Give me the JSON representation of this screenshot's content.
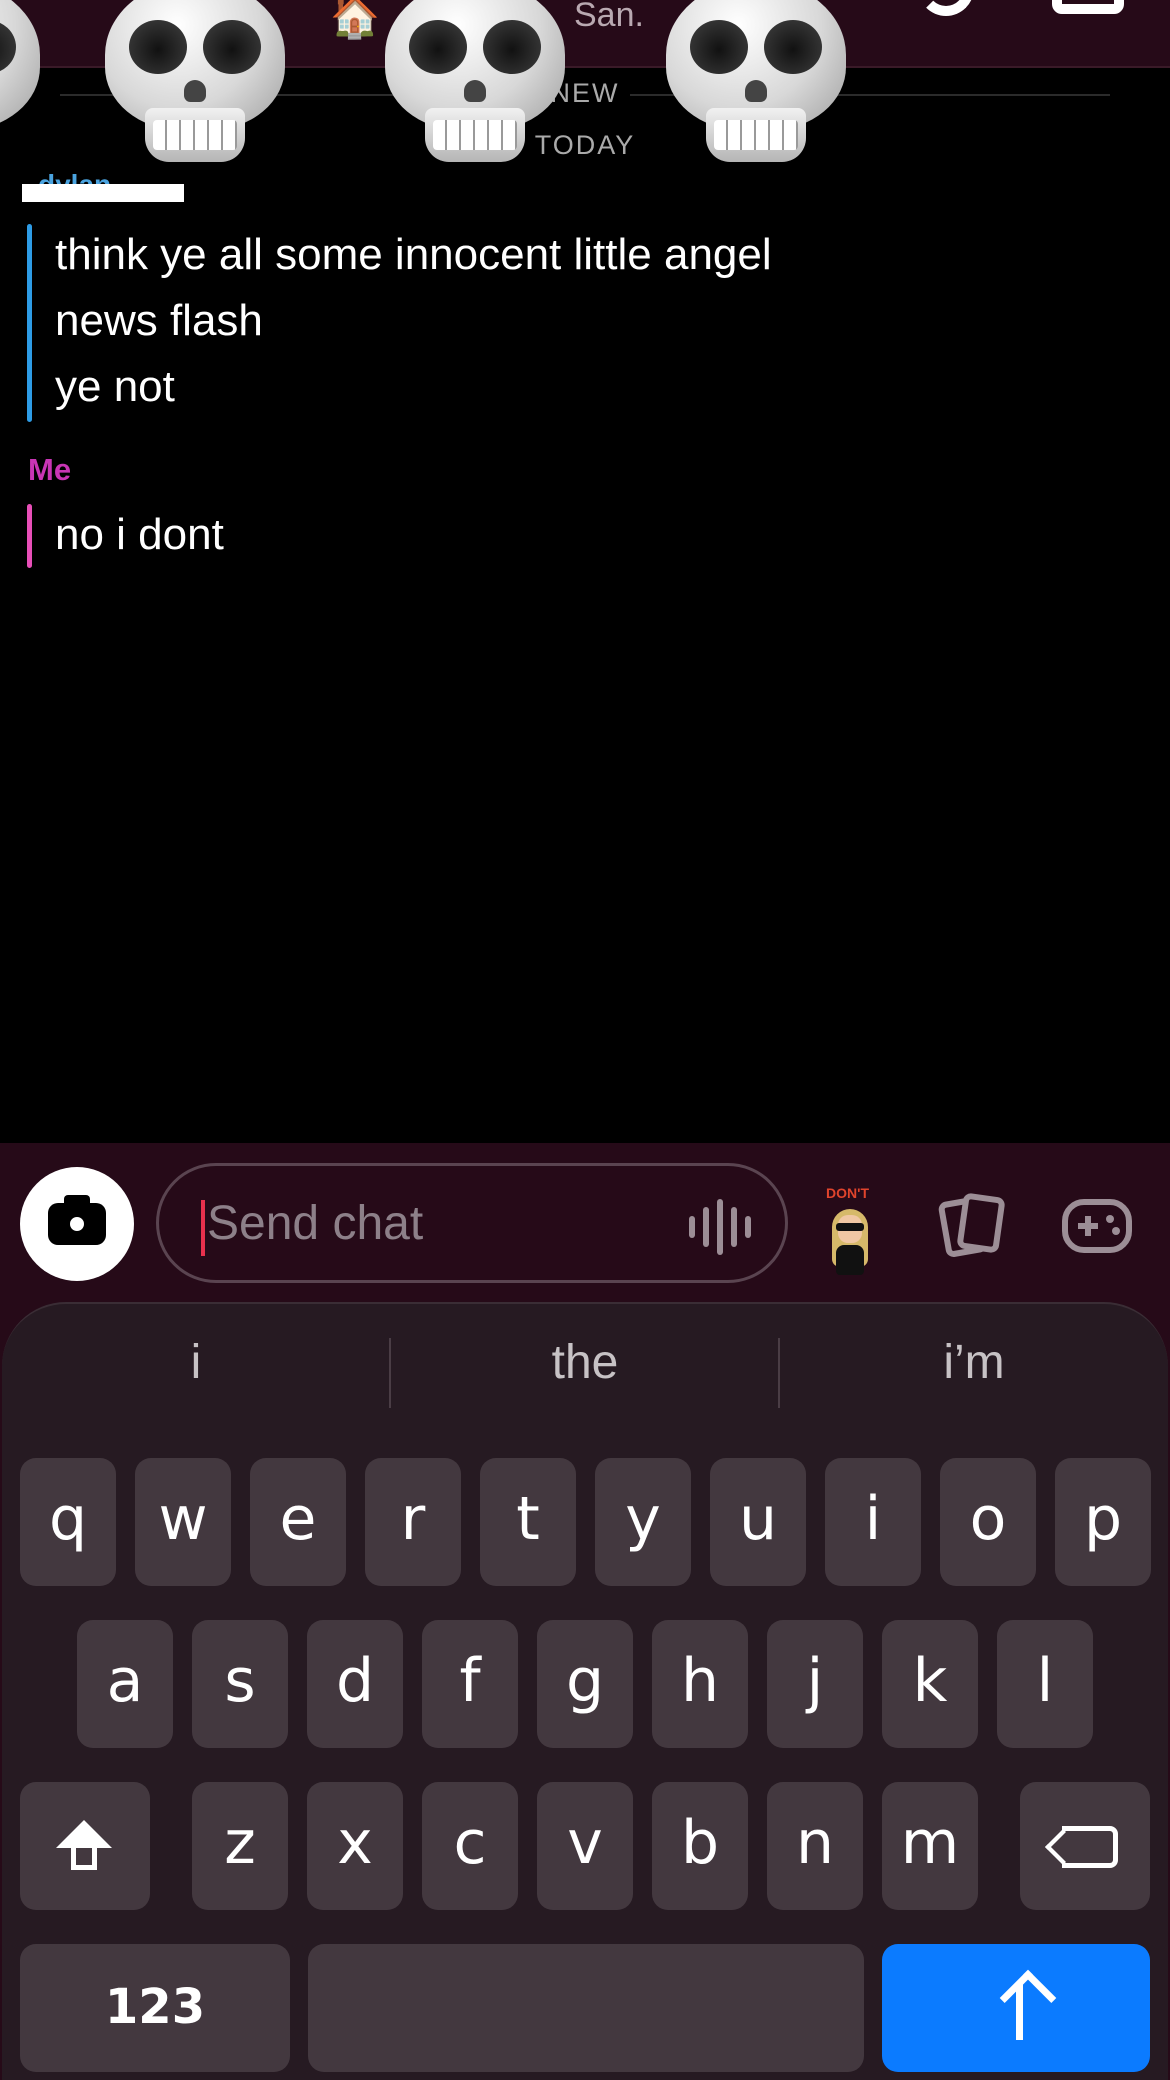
{
  "header": {
    "house_emoji": "🏠",
    "title_partial": "San.",
    "emoji_name": "skull-emoji"
  },
  "divider": {
    "new_label": "NEW",
    "today_label": "TODAY"
  },
  "messages": {
    "them": {
      "sender_peek": "dylan",
      "lines": [
        "think ye all some innocent little angel",
        "news flash",
        "ye not"
      ],
      "color": "#2e9ce6"
    },
    "me": {
      "sender": "Me",
      "lines": [
        "no i dont"
      ],
      "color": "#e84fb8"
    }
  },
  "composer": {
    "placeholder": "Send chat",
    "bitmoji_caption": "DON'T",
    "icons": [
      "camera-icon",
      "voice-icon",
      "bitmoji-sticker",
      "memories-icon",
      "games-icon"
    ]
  },
  "keyboard": {
    "suggestions": [
      "i",
      "the",
      "i’m"
    ],
    "row1": [
      "q",
      "w",
      "e",
      "r",
      "t",
      "y",
      "u",
      "i",
      "o",
      "p"
    ],
    "row2": [
      "a",
      "s",
      "d",
      "f",
      "g",
      "h",
      "j",
      "k",
      "l"
    ],
    "row3": [
      "z",
      "x",
      "c",
      "v",
      "b",
      "n",
      "m"
    ],
    "numbers_key": "123",
    "send_color": "#0b7bff"
  }
}
